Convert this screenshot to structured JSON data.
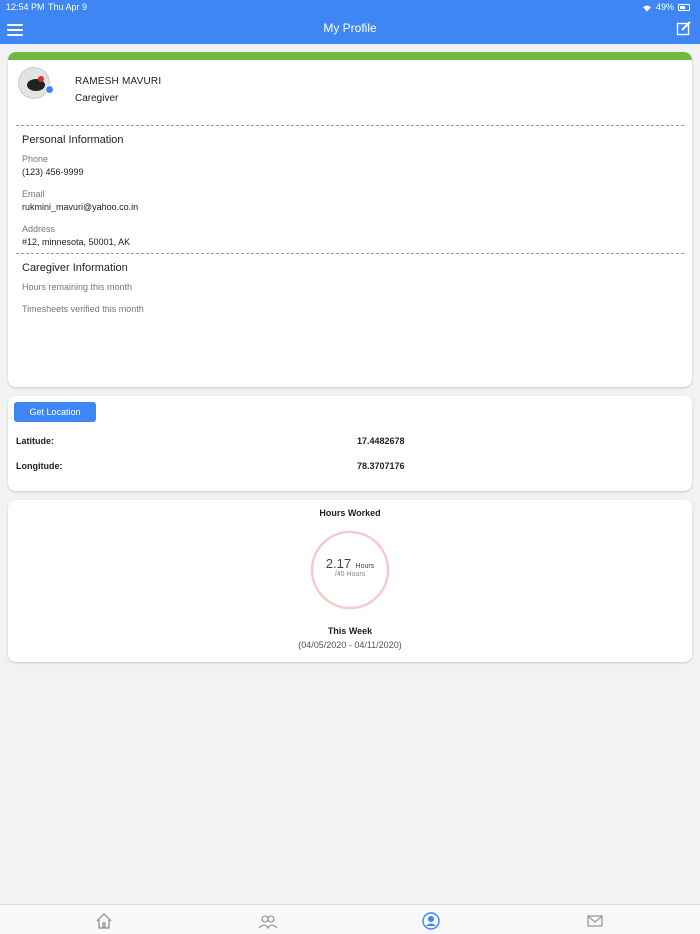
{
  "status_bar": {
    "time": "12:54 PM",
    "date": "Thu Apr 9",
    "battery": "49%"
  },
  "nav": {
    "title": "My Profile",
    "left_icon": "hamburger-menu-icon",
    "right_icon": "edit-icon"
  },
  "profile": {
    "name": "RAMESH MAVURI",
    "role": "Caregiver",
    "personal_title": "Personal Information",
    "phone_label": "Phone",
    "phone_value": "(123) 456-9999",
    "email_label": "Email",
    "email_value": "rukmini_mavuri@yahoo.co.in",
    "address_label": "Address",
    "address_value": "#12, minnesota, 50001, AK",
    "caregiver_title": "Caregiver Information",
    "hours_remaining_label": "Hours remaining this month",
    "timesheets_label": "Timesheets verified this month",
    "accent_color": "#70b843"
  },
  "location": {
    "button_label": "Get Location",
    "latitude_label": "Latitude:",
    "latitude_value": "17.4482678",
    "longitude_label": "Longitude:",
    "longitude_value": "78.3707176"
  },
  "hours": {
    "title": "Hours Worked",
    "value": "2.17",
    "unit": "Hours",
    "total": "/40 Hours",
    "progress_fraction": 0.054,
    "week_label": "This Week",
    "week_range": "(04/05/2020 - 04/11/2020)",
    "progress_color": "#f06a1c",
    "ring_color": "#f7c9c9"
  },
  "tabbar": {
    "tabs": [
      "home-icon",
      "people-icon",
      "profile-icon",
      "mail-icon"
    ],
    "active": "profile-icon",
    "active_color": "#3f86f5"
  }
}
